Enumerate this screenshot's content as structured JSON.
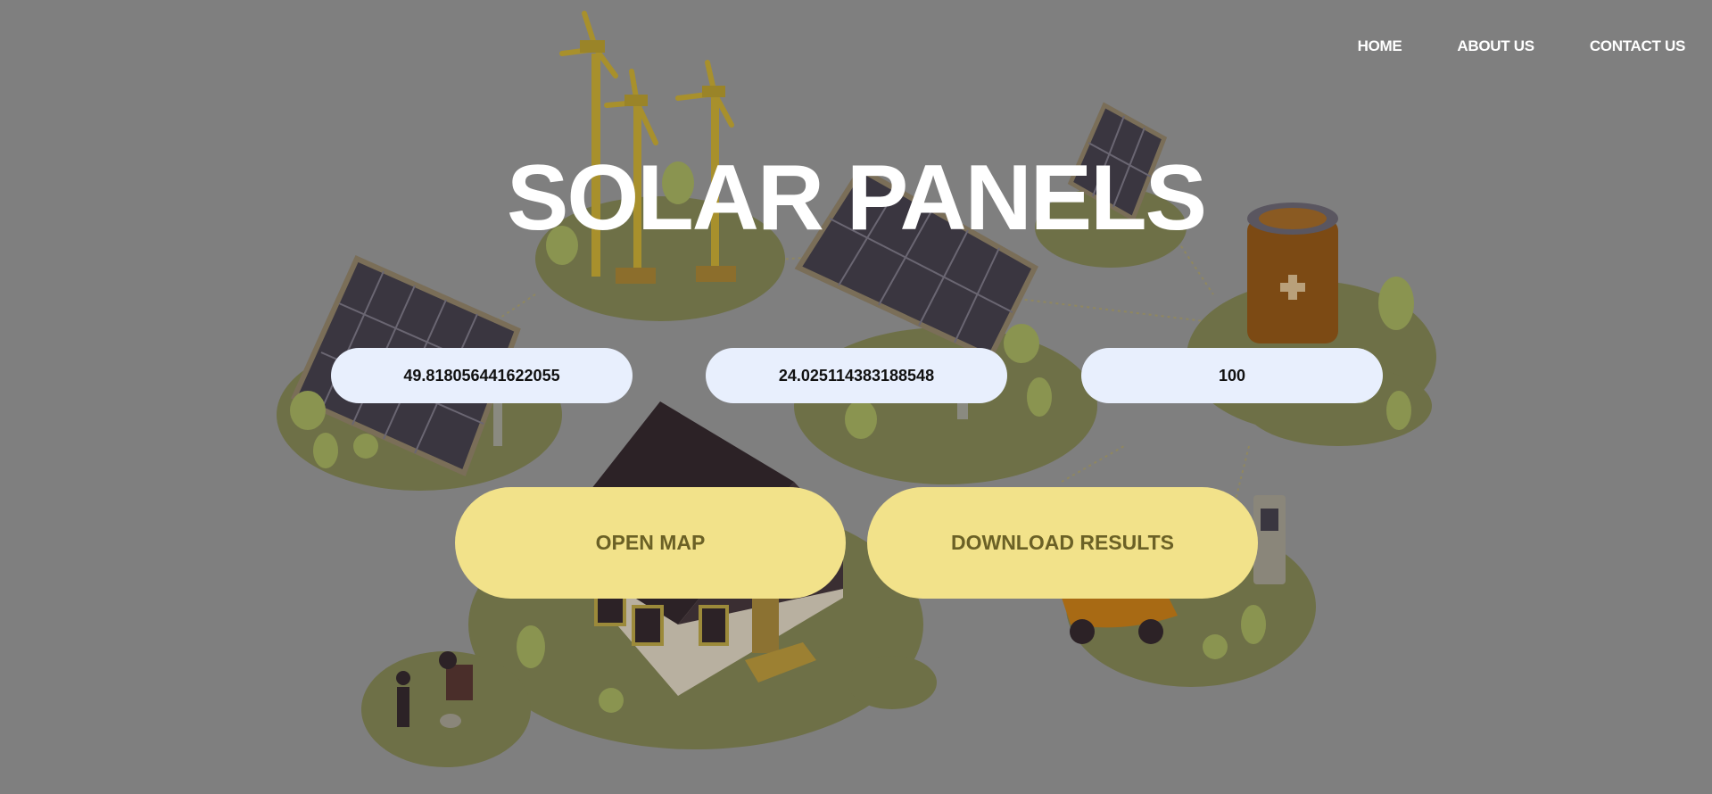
{
  "nav": {
    "items": [
      {
        "label": "HOME"
      },
      {
        "label": "ABOUT US"
      },
      {
        "label": "CONTACT US"
      }
    ]
  },
  "hero": {
    "title": "SOLAR PANELS"
  },
  "inputs": {
    "latitude": {
      "value": "49.818056441622055"
    },
    "longitude": {
      "value": "24.025114383188548"
    },
    "third": {
      "value": "100"
    }
  },
  "buttons": {
    "open_map": "OPEN MAP",
    "download_results": "DOWNLOAD RESULTS"
  },
  "colors": {
    "overlay": "#7f7f7f",
    "input_bg": "#e8effd",
    "button_bg": "#f2e28a",
    "button_text": "#6b6126",
    "island": "#6e7047"
  }
}
